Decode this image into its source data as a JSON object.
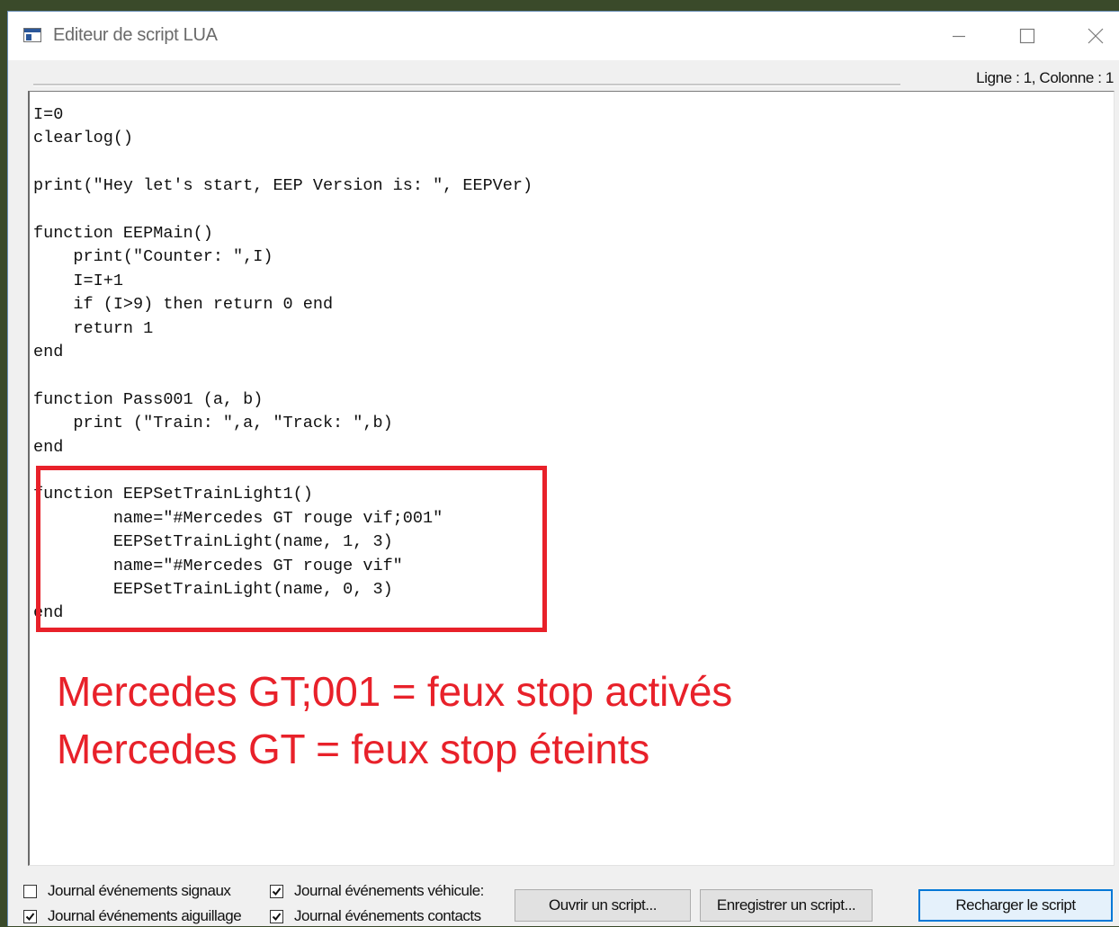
{
  "window": {
    "title": "Editeur de script LUA",
    "controls": {
      "minimize": "minimize-icon",
      "maximize": "maximize-icon",
      "close": "close-icon"
    }
  },
  "status": {
    "position": "Ligne : 1, Colonne : 1"
  },
  "editor": {
    "lines": [
      "I=0",
      "clearlog()",
      "",
      "print(\"Hey let's start, EEP Version is: \", EEPVer)",
      "",
      "function EEPMain()",
      "    print(\"Counter: \",I)",
      "    I=I+1",
      "    if (I>9) then return 0 end",
      "    return 1",
      "end",
      "",
      "function Pass001 (a, b)",
      "    print (\"Train: \",a, \"Track: \",b)",
      "end",
      "",
      "function EEPSetTrainLight1()",
      "        name=\"#Mercedes GT rouge vif;001\"",
      "        EEPSetTrainLight(name, 1, 3)",
      "        name=\"#Mercedes GT rouge vif\"",
      "        EEPSetTrainLight(name, 0, 3)",
      "end"
    ]
  },
  "annotation": {
    "line1": "Mercedes GT;001 = feux stop activés",
    "line2": "Mercedes GT = feux stop éteints",
    "color": "#e8212a"
  },
  "options": {
    "signals": {
      "label": "Journal événements signaux",
      "checked": false
    },
    "vehicles": {
      "label": "Journal événements véhicule:",
      "checked": true
    },
    "switches": {
      "label": "Journal événements aiguillage",
      "checked": true
    },
    "contacts": {
      "label": "Journal événements contacts",
      "checked": true
    }
  },
  "buttons": {
    "open": "Ouvrir un script...",
    "save": "Enregistrer un script...",
    "reload": "Recharger le script"
  },
  "colors": {
    "accent": "#0078d7",
    "highlight": "#e8212a"
  }
}
